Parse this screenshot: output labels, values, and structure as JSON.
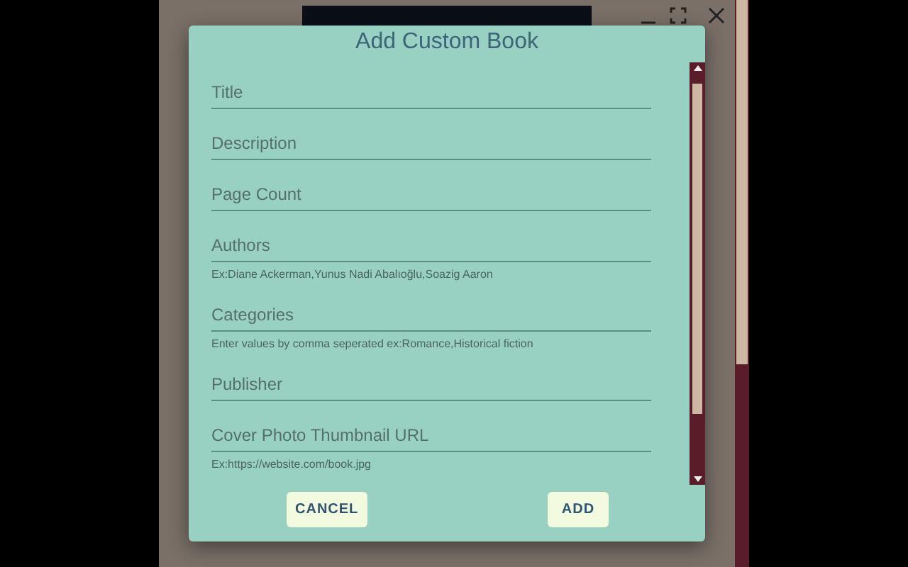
{
  "dialog": {
    "title": "Add Custom Book",
    "fields": [
      {
        "placeholder": "Title"
      },
      {
        "placeholder": "Description"
      },
      {
        "placeholder": "Page Count"
      },
      {
        "placeholder": "Authors",
        "helper": "Ex:Diane Ackerman,Yunus Nadi Abalıoğlu,Soazig Aaron"
      },
      {
        "placeholder": "Categories",
        "helper": "Enter values by comma seperated ex:Romance,Historical fiction"
      },
      {
        "placeholder": "Publisher"
      },
      {
        "placeholder": "Cover Photo Thumbnail URL",
        "helper": "Ex:https://website.com/book.jpg"
      }
    ],
    "buttons": [
      {
        "label": "CANCEL"
      },
      {
        "label": "ADD"
      }
    ]
  }
}
